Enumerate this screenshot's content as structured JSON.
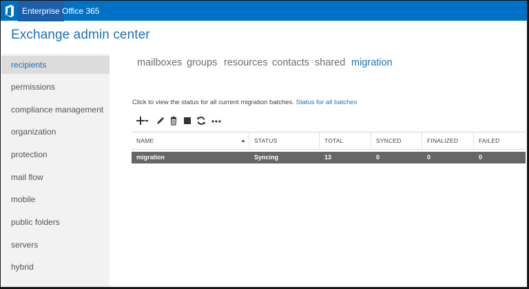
{
  "topbar": {
    "logo_icon": "office-logo-icon",
    "tabs": [
      {
        "label": "Enterprise",
        "active": true
      },
      {
        "label": "Office 365",
        "active": false
      }
    ],
    "color": "#0071c5"
  },
  "header": {
    "title": "Exchange admin center"
  },
  "leftnav": {
    "items": [
      {
        "label": "recipients",
        "selected": true
      },
      {
        "label": "permissions"
      },
      {
        "label": "compliance management"
      },
      {
        "label": "organization"
      },
      {
        "label": "protection"
      },
      {
        "label": "mail flow"
      },
      {
        "label": "mobile"
      },
      {
        "label": "public folders"
      },
      {
        "label": "servers"
      },
      {
        "label": "hybrid"
      }
    ]
  },
  "subtabs": [
    {
      "label": "mailboxes"
    },
    {
      "label": "groups"
    },
    {
      "label": "resources"
    },
    {
      "label": "contacts"
    },
    {
      "label": "shared"
    },
    {
      "label": "migration",
      "active": true
    }
  ],
  "info": {
    "text": "Click to view the status for all current migration batches.",
    "link": "Status for all batches"
  },
  "toolbar": {
    "icons": [
      "add-icon",
      "dropdown-caret-icon",
      "edit-pencil-icon",
      "delete-trash-icon",
      "stop-icon",
      "refresh-icon",
      "more-icon"
    ]
  },
  "table": {
    "columns": [
      "NAME",
      "STATUS",
      "TOTAL",
      "SYNCED",
      "FINALIZED",
      "FAILED"
    ],
    "rows": [
      {
        "name": "migration",
        "status": "Syncing",
        "total": "13",
        "synced": "0",
        "finalized": "0",
        "failed": "0"
      }
    ],
    "selected_row_color": "#666666"
  }
}
